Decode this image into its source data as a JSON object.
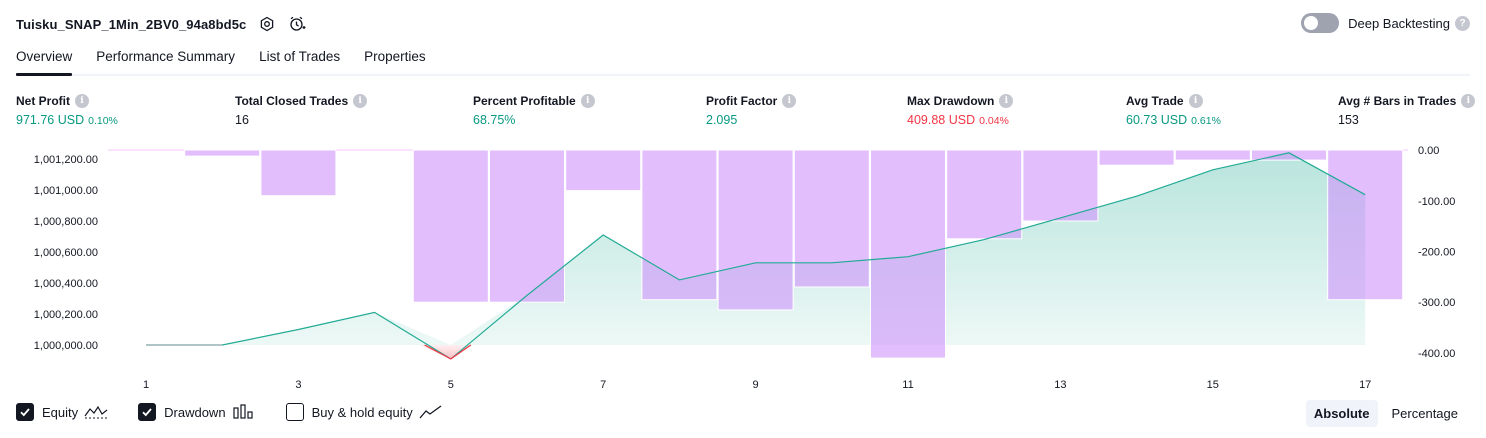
{
  "header": {
    "strategy_title": "Tuisku_SNAP_1Min_2BV0_94a8bd5c",
    "deep_backtesting_label": "Deep Backtesting",
    "deep_backtesting_on": false
  },
  "tabs": [
    {
      "label": "Overview",
      "active": true
    },
    {
      "label": "Performance Summary",
      "active": false
    },
    {
      "label": "List of Trades",
      "active": false
    },
    {
      "label": "Properties",
      "active": false
    }
  ],
  "stats": [
    {
      "label": "Net Profit",
      "value": "971.76 USD",
      "pct": "0.10%",
      "tone": "green"
    },
    {
      "label": "Total Closed Trades",
      "value": "16",
      "pct": "",
      "tone": "dark"
    },
    {
      "label": "Percent Profitable",
      "value": "68.75%",
      "pct": "",
      "tone": "green"
    },
    {
      "label": "Profit Factor",
      "value": "2.095",
      "pct": "",
      "tone": "green"
    },
    {
      "label": "Max Drawdown",
      "value": "409.88 USD",
      "pct": "0.04%",
      "tone": "red"
    },
    {
      "label": "Avg Trade",
      "value": "60.73 USD",
      "pct": "0.61%",
      "tone": "green"
    },
    {
      "label": "Avg # Bars in Trades",
      "value": "153",
      "pct": "",
      "tone": "dark"
    }
  ],
  "chart_data": {
    "type": "line",
    "x": [
      1,
      2,
      3,
      4,
      5,
      6,
      7,
      8,
      9,
      10,
      11,
      12,
      13,
      14,
      15,
      16,
      17
    ],
    "x_ticks": [
      "1",
      "3",
      "5",
      "7",
      "9",
      "11",
      "13",
      "15",
      "17"
    ],
    "series": [
      {
        "name": "Equity",
        "axis": "left",
        "kind": "area-line",
        "values": [
          1000000,
          1000000,
          1000100,
          1000210,
          999910,
          1000320,
          1000710,
          1000420,
          1000530,
          1000530,
          1000570,
          1000680,
          1000820,
          1000960,
          1001130,
          1001240,
          1000970
        ]
      },
      {
        "name": "Drawdown",
        "axis": "right",
        "kind": "bar",
        "values": [
          0,
          -12,
          -90,
          0,
          -300,
          -300,
          -80,
          -295,
          -315,
          -270,
          -410,
          -175,
          -140,
          -30,
          -20,
          -20,
          -295
        ]
      }
    ],
    "left_axis": {
      "ticks": [
        "1,001,200.00",
        "1,001,000.00",
        "1,000,800.00",
        "1,000,600.00",
        "1,000,400.00",
        "1,000,200.00",
        "1,000,000.00"
      ],
      "range": [
        999910,
        1001240
      ]
    },
    "right_axis": {
      "ticks": [
        "0.00",
        "-100.00",
        "-200.00",
        "-300.00",
        "-400.00"
      ],
      "range": [
        -400,
        0
      ]
    },
    "colors": {
      "equity_line": "#22ab94",
      "equity_fill": "#22ab94",
      "equity_loss": "#f23645",
      "drawdown_bar": "#ce93fc"
    }
  },
  "legend": [
    {
      "label": "Equity",
      "checked": true,
      "icon": "equity-line-icon"
    },
    {
      "label": "Drawdown",
      "checked": true,
      "icon": "drawdown-bars-icon"
    },
    {
      "label": "Buy & hold equity",
      "checked": false,
      "icon": "buyhold-line-icon"
    }
  ],
  "modes": [
    {
      "label": "Absolute",
      "active": true
    },
    {
      "label": "Percentage",
      "active": false
    }
  ]
}
